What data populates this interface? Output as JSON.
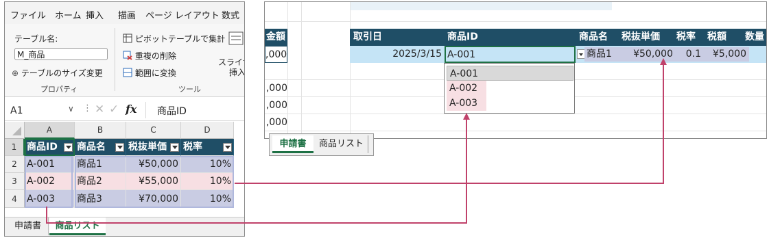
{
  "left_window": {
    "menu": [
      "ファイル",
      "ホーム",
      "挿入",
      "描画",
      "ページ レイアウト",
      "数式"
    ],
    "ribbon": {
      "table_name_label": "テーブル名:",
      "table_name_value": "M_商品",
      "resize_label": "テーブルのサイズ変更",
      "properties_group": "プロパティ",
      "pivot_label": "ピボットテーブルで集計",
      "remove_dup_label": "重複の削除",
      "convert_label": "範囲に変換",
      "slicer_label_1": "スライサ",
      "slicer_label_2": "挿入",
      "tools_group": "ツール"
    },
    "formula_bar": {
      "name_box": "A1",
      "fx": "fx",
      "formula": "商品ID"
    },
    "columns": [
      "A",
      "B",
      "C",
      "D"
    ],
    "rows": [
      "1",
      "2",
      "3",
      "4"
    ],
    "table": {
      "headers": [
        "商品ID",
        "商品名",
        "税抜単価",
        "税率"
      ],
      "rows": [
        [
          "A-001",
          "商品1",
          "¥50,000",
          "10%"
        ],
        [
          "A-002",
          "商品2",
          "¥55,000",
          "10%"
        ],
        [
          "A-003",
          "商品3",
          "¥70,000",
          "10%"
        ]
      ]
    },
    "sheet_tabs": [
      "申請書",
      "商品リスト"
    ]
  },
  "right_window": {
    "left_partial_header": "金額",
    "left_partial_values": [
      ",000",
      ",000",
      ",000",
      ",000"
    ],
    "headers": [
      "取引日",
      "商品ID",
      "商品名",
      "税抜単価",
      "税率",
      "税額",
      "数量"
    ],
    "row": {
      "date": "2025/3/15",
      "product_id": "A-001",
      "product_name": "商品1",
      "unit_price": "¥50,000",
      "tax_rate": "0.1",
      "tax": "¥5,000"
    },
    "dropdown": [
      "A-001",
      "A-002",
      "A-003"
    ],
    "sheet_tabs": [
      "申請書",
      "商品リスト"
    ]
  },
  "colors": {
    "header_bg": "#1f4e66",
    "row_blue": "#c9cce3",
    "row_pink": "#f7dfe3",
    "connector": "#c0416a",
    "selected_fill": "#c5e4f6"
  }
}
